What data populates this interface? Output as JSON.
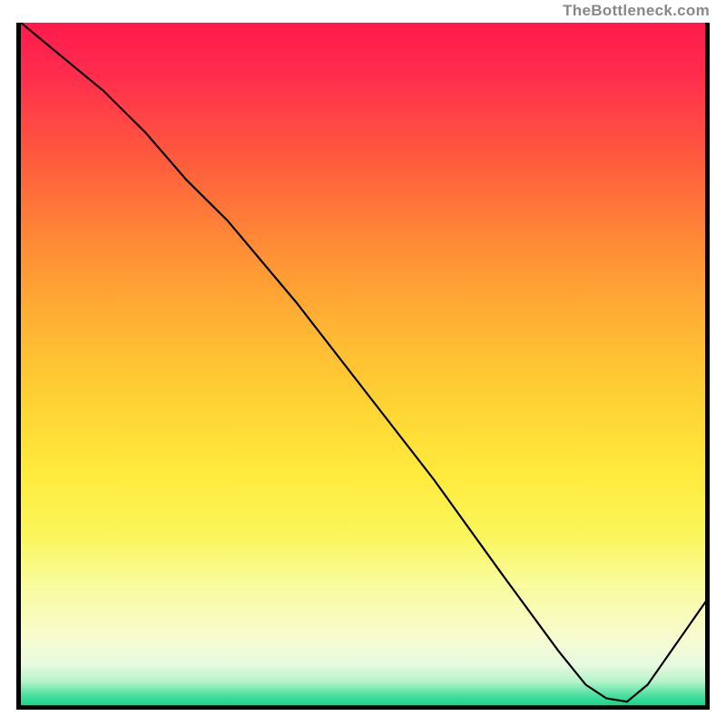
{
  "watermark": "TheBottleneck.com",
  "annotation_label": "",
  "chart_data": {
    "type": "line",
    "title": "",
    "xlabel": "",
    "ylabel": "",
    "xlim": [
      0,
      100
    ],
    "ylim": [
      0,
      100
    ],
    "series": [
      {
        "name": "curve",
        "x": [
          0,
          6,
          12,
          18,
          24,
          30,
          40,
          50,
          60,
          70,
          78,
          82,
          85,
          88,
          91,
          100
        ],
        "y": [
          100,
          95,
          90,
          84,
          77,
          71,
          59,
          46,
          33,
          19,
          8,
          3,
          1,
          0.5,
          3,
          16
        ]
      }
    ],
    "gradient_background": {
      "orientation": "vertical",
      "stops": [
        {
          "pos": 0.0,
          "color": "#ff1a4d"
        },
        {
          "pos": 0.2,
          "color": "#ff5b3d"
        },
        {
          "pos": 0.44,
          "color": "#ffb333"
        },
        {
          "pos": 0.66,
          "color": "#ffea3d"
        },
        {
          "pos": 0.9,
          "color": "#f8fccf"
        },
        {
          "pos": 1.0,
          "color": "#14d68f"
        }
      ]
    }
  }
}
